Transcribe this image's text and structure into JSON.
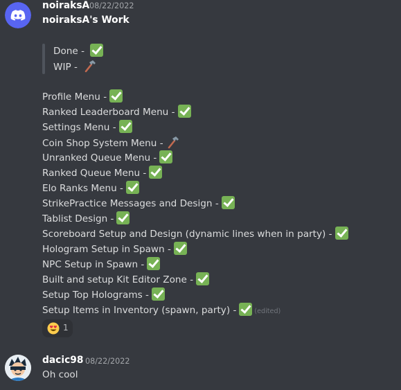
{
  "messages": [
    {
      "username": "noiraksA",
      "timestamp": "08/22/2022",
      "title": "noiraksA's Work",
      "legend": [
        {
          "text": "Done -",
          "status": "check"
        },
        {
          "text": "WIP -",
          "status": "hammer"
        }
      ],
      "items": [
        {
          "text": "Profile Menu -",
          "status": "check"
        },
        {
          "text": "Ranked Leaderboard Menu -",
          "status": "check"
        },
        {
          "text": "Settings Menu -",
          "status": "check"
        },
        {
          "text": "Coin Shop System Menu -",
          "status": "hammer"
        },
        {
          "text": "Unranked Queue Menu -",
          "status": "check"
        },
        {
          "text": "Ranked Queue Menu -",
          "status": "check"
        },
        {
          "text": "Elo Ranks Menu -",
          "status": "check"
        },
        {
          "text": "StrikePractice Messages and Design -",
          "status": "check"
        },
        {
          "text": "Tablist Design -",
          "status": "check"
        },
        {
          "text": "Scoreboard Setup and Design (dynamic lines when in party) -",
          "status": "check"
        },
        {
          "text": "Hologram Setup in Spawn -",
          "status": "check"
        },
        {
          "text": "NPC Setup in Spawn -",
          "status": "check"
        },
        {
          "text": "Built and setup Kit Editor Zone -",
          "status": "check"
        },
        {
          "text": "Setup Top Holograms -",
          "status": "check"
        },
        {
          "text": "Setup Items in Inventory (spawn, party) -",
          "status": "check"
        }
      ],
      "edited_label": "(edited)",
      "reaction": {
        "emoji": "heart-eyes-emoji",
        "count": "1"
      }
    },
    {
      "username": "dacic98",
      "timestamp": "08/22/2022",
      "text": "Oh cool"
    }
  ],
  "icons": {
    "check": "white-check-mark-icon",
    "hammer": "hammer-icon"
  },
  "colors": {
    "background": "#36393f",
    "discord_blurple": "#5865f2",
    "check_green": "#77b255",
    "text": "#dcddde",
    "username": "#ffffff",
    "timestamp": "#a3a6aa"
  }
}
